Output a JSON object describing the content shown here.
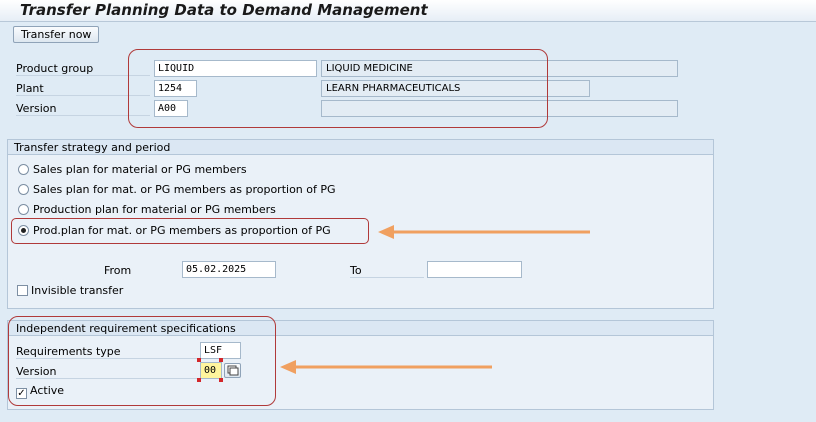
{
  "window": {
    "title": "Transfer Planning Data to Demand Management"
  },
  "toolbar": {
    "transfer_label": "Transfer now"
  },
  "header_fields": {
    "product_group": {
      "label": "Product group",
      "value": "LIQUID",
      "description": "LIQUID MEDICINE"
    },
    "plant": {
      "label": "Plant",
      "value": "1254",
      "description": "LEARN PHARMACEUTICALS"
    },
    "version": {
      "label": "Version",
      "value": "A00",
      "description": ""
    }
  },
  "strategy": {
    "title": "Transfer strategy and period",
    "options": [
      {
        "label": "Sales plan for material or PG members",
        "checked": false
      },
      {
        "label": "Sales plan for mat. or PG members as proportion of PG",
        "checked": false
      },
      {
        "label": "Production plan for material or PG members",
        "checked": false
      },
      {
        "label": "Prod.plan for mat. or PG members as proportion of PG",
        "checked": true
      }
    ],
    "from_label": "From",
    "from_value": "05.02.2025",
    "to_label": "To",
    "to_value": "",
    "invisible_label": "Invisible transfer",
    "invisible_checked": false
  },
  "requirements": {
    "title": "Independent requirement specifications",
    "type_label": "Requirements type",
    "type_value": "LSF",
    "version_label": "Version",
    "version_value": "00",
    "active_label": "Active",
    "active_checked": true,
    "check_glyph": "✓"
  },
  "colors": {
    "highlight_box": "#b03a3a",
    "arrow": "#f0a060",
    "background": "#dfebf5",
    "focus_field": "#fff59d"
  },
  "icons": {
    "matchcode": "matchcode-help-icon",
    "arrow": "arrow-left-icon"
  }
}
